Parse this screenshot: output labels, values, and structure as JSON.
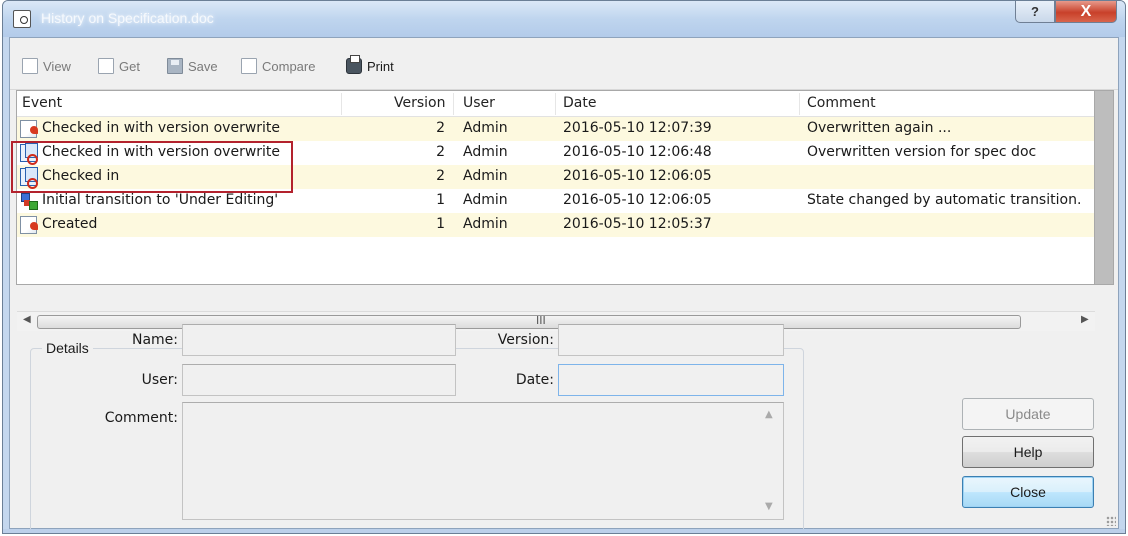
{
  "window": {
    "title": "History on Specification.doc",
    "help_label": "?",
    "close_label": "X"
  },
  "toolbar": {
    "view": "View",
    "get": "Get",
    "save": "Save",
    "compare": "Compare",
    "print": "Print"
  },
  "table": {
    "columns": [
      "Event",
      "Version",
      "User",
      "Date",
      "Comment"
    ],
    "rows": [
      {
        "icon": "document-edit-icon",
        "event": "Checked in with version overwrite",
        "version": "2",
        "user": "Admin",
        "date": "2016-05-10 12:07:39",
        "comment": "Overwritten again ..."
      },
      {
        "icon": "checkin-icon",
        "event": "Checked in with version overwrite",
        "version": "2",
        "user": "Admin",
        "date": "2016-05-10 12:06:48",
        "comment": "Overwritten version for spec doc"
      },
      {
        "icon": "checkin-icon",
        "event": "Checked in",
        "version": "2",
        "user": "Admin",
        "date": "2016-05-10 12:06:05",
        "comment": ""
      },
      {
        "icon": "transition-icon",
        "event": "Initial transition to 'Under Editing'",
        "version": "1",
        "user": "Admin",
        "date": "2016-05-10 12:06:05",
        "comment": "State changed by automatic transition."
      },
      {
        "icon": "document-edit-icon",
        "event": "Created",
        "version": "1",
        "user": "Admin",
        "date": "2016-05-10 12:05:37",
        "comment": ""
      }
    ],
    "hscroll_grip": "III"
  },
  "details": {
    "legend": "Details",
    "name_label": "Name:",
    "version_label": "Version:",
    "user_label": "User:",
    "date_label": "Date:",
    "comment_label": "Comment:",
    "name_value": "",
    "version_value": "",
    "user_value": "",
    "date_value": "",
    "comment_value": ""
  },
  "buttons": {
    "update": "Update",
    "help": "Help",
    "close": "Close"
  },
  "colors": {
    "alt_row": "#fdf9df",
    "highlight_border": "#b3222d",
    "default_button": "#3c7fb1"
  }
}
